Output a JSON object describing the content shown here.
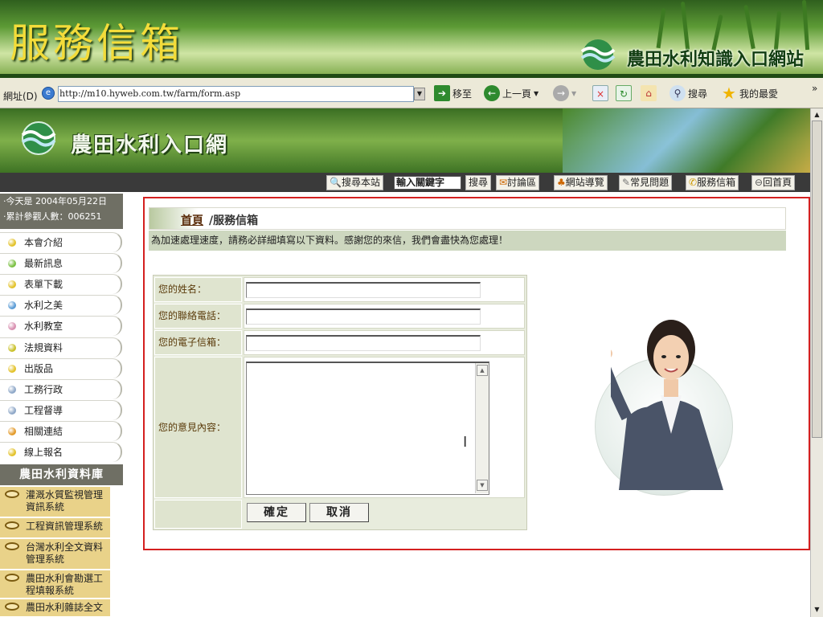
{
  "banner": {
    "title": "服務信箱",
    "site_name": "農田水利知識入口網站"
  },
  "browser": {
    "address_label": "網址(D)",
    "url": "http://m10.hyweb.com.tw/farm/form.asp",
    "go_label": "移至",
    "back_label": "上一頁",
    "search_label": "搜尋",
    "favorites_label": "我的最愛",
    "more_label": "»"
  },
  "site": {
    "title": "農田水利入口網"
  },
  "nav": {
    "search_site": "搜尋本站",
    "search_placeholder": "輸入關鍵字",
    "search_button": "搜尋",
    "forum": "討論區",
    "sitemap": "網站導覽",
    "faq": "常見問題",
    "mailbox": "服務信箱",
    "home": "回首頁"
  },
  "sidebar": {
    "date_text": "‧今天是 2004年05月22日",
    "visits_text": "‧累計參觀人數：006251",
    "items": [
      {
        "label": "本會介紹",
        "color": "#e3c22a"
      },
      {
        "label": "最新訊息",
        "color": "#7bc043"
      },
      {
        "label": "表單下載",
        "color": "#e3c22a"
      },
      {
        "label": "水利之美",
        "color": "#5a9bd5"
      },
      {
        "label": "水利教室",
        "color": "#d88fb0"
      },
      {
        "label": "法規資料",
        "color": "#c9c12a"
      },
      {
        "label": "出版品",
        "color": "#e3c22a"
      },
      {
        "label": "工務行政",
        "color": "#8fa8c8"
      },
      {
        "label": "工程督導",
        "color": "#8fa8c8"
      },
      {
        "label": "相關連結",
        "color": "#e39a2a"
      },
      {
        "label": "線上報名",
        "color": "#e3c22a"
      }
    ],
    "db_title": "農田水利資料庫",
    "db_items": [
      "灌溉水質監視管理資訊系統",
      "工程資訊管理系統",
      "台灣水利全文資料管理系統",
      "農田水利會勘選工程填報系統",
      "農田水利雜誌全文"
    ]
  },
  "main": {
    "breadcrumb_home": "首頁",
    "breadcrumb_rest": "/服務信箱",
    "notice": "為加速處理速度，請務必詳細填寫以下資料。感謝您的來信，我們會盡快為您處理！",
    "form": {
      "name_label": "您的姓名：",
      "phone_label": "您的聯絡電話：",
      "email_label": "您的電子信箱：",
      "message_label": "您的意見內容：",
      "name_value": "",
      "phone_value": "",
      "email_value": "",
      "message_value": "",
      "submit_label": "確定",
      "cancel_label": "取消"
    }
  }
}
